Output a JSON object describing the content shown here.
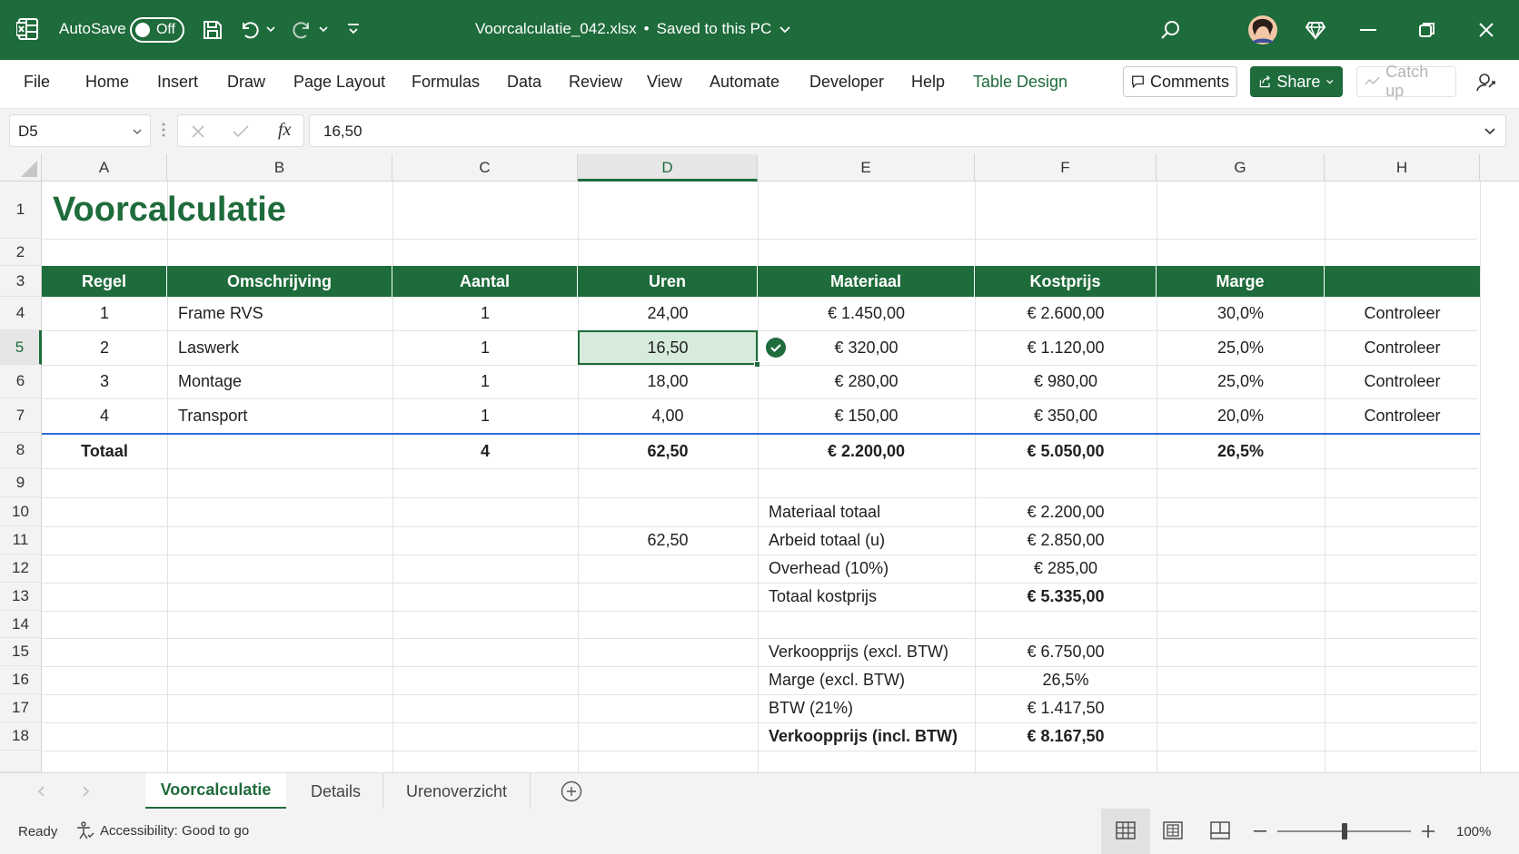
{
  "titlebar": {
    "autosave_label": "AutoSave",
    "autosave_state": "Off",
    "document_title": "Voorcalculatie_042.xlsx",
    "separator": "•",
    "save_status": "Saved to this PC"
  },
  "ribbon": {
    "tabs": [
      "File",
      "Home",
      "Insert",
      "Draw",
      "Page Layout",
      "Formulas",
      "Data",
      "Review",
      "View",
      "Automate",
      "Developer",
      "Help",
      "Table Design"
    ],
    "comments_label": "Comments",
    "share_label": "Share",
    "catchup_label": "Catch up"
  },
  "formula_bar": {
    "name_box": "D5",
    "fx_label": "fx",
    "value": "16,50"
  },
  "columns": [
    "A",
    "B",
    "C",
    "D",
    "E",
    "F",
    "G",
    "H"
  ],
  "rows": [
    "1",
    "2",
    "3",
    "4",
    "5",
    "6",
    "7",
    "8",
    "9",
    "10",
    "11",
    "12",
    "13",
    "14",
    "15",
    "16",
    "17",
    "18"
  ],
  "sheet": {
    "title": "Voorcalculatie",
    "headers": [
      "Regel",
      "Omschrijving",
      "Aantal",
      "Uren",
      "Materiaal",
      "Kostprijs",
      "Marge"
    ],
    "table_rows": [
      {
        "regel": "1",
        "omschrijving": "Frame RVS",
        "aantal": "1",
        "uren": "24,00",
        "materiaal": "€ 1.450,00",
        "kostprijs": "€ 2.600,00",
        "marge": "30,0%",
        "status": "Controleer"
      },
      {
        "regel": "2",
        "omschrijving": "Laswerk",
        "aantal": "1",
        "uren": "16,50",
        "materiaal": "€ 320,00",
        "kostprijs": "€ 1.120,00",
        "marge": "25,0%",
        "status": "Controleer"
      },
      {
        "regel": "3",
        "omschrijving": "Montage",
        "aantal": "1",
        "uren": "18,00",
        "materiaal": "€ 280,00",
        "kostprijs": "€ 980,00",
        "marge": "25,0%",
        "status": "Controleer"
      },
      {
        "regel": "4",
        "omschrijving": "Transport",
        "aantal": "1",
        "uren": "4,00",
        "materiaal": "€ 150,00",
        "kostprijs": "€ 350,00",
        "marge": "20,0%",
        "status": "Controleer"
      }
    ],
    "total": {
      "label": "Totaal",
      "aantal": "4",
      "uren": "62,50",
      "materiaal": "€ 2.200,00",
      "kostprijs": "€ 5.050,00",
      "marge": "26,5%"
    },
    "d11": "62,50",
    "summary": [
      {
        "label": "Materiaal totaal",
        "value": "€ 2.200,00"
      },
      {
        "label": "Arbeid totaal (u)",
        "value": "€ 2.850,00"
      },
      {
        "label": "Overhead (10%)",
        "value": "€ 285,00"
      },
      {
        "label": "Totaal kostprijs",
        "value": "€ 5.335,00"
      },
      {
        "label": "Verkoopprijs (excl. BTW)",
        "value": "€ 6.750,00"
      },
      {
        "label": "Marge (excl. BTW)",
        "value": "26,5%"
      },
      {
        "label": "BTW (21%)",
        "value": "€ 1.417,50"
      },
      {
        "label": "Verkoopprijs (incl. BTW)",
        "value": "€ 8.167,50"
      }
    ]
  },
  "sheet_tabs": [
    "Voorcalculatie",
    "Details",
    "Urenoverzicht"
  ],
  "status_bar": {
    "ready": "Ready",
    "accessibility": "Accessibility: Good to go",
    "zoom": "100%"
  },
  "colors": {
    "accent": "#1e6b3b",
    "selection_fill": "#d7ebdc",
    "table_divider": "#2f6fd6"
  }
}
